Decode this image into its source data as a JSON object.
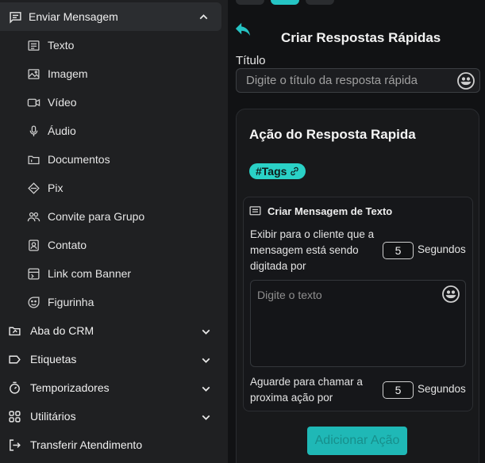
{
  "sidebar": {
    "section": {
      "label": "Enviar Mensagem",
      "icon": "message-icon",
      "expanded": true
    },
    "sub_items": [
      {
        "label": "Texto",
        "icon": "text-icon"
      },
      {
        "label": "Imagem",
        "icon": "image-icon"
      },
      {
        "label": "Vídeo",
        "icon": "video-icon"
      },
      {
        "label": "Áudio",
        "icon": "microphone-icon"
      },
      {
        "label": "Documentos",
        "icon": "folder-icon"
      },
      {
        "label": "Pix",
        "icon": "pix-icon"
      },
      {
        "label": "Convite para Grupo",
        "icon": "group-icon"
      },
      {
        "label": "Contato",
        "icon": "contact-icon"
      },
      {
        "label": "Link com Banner",
        "icon": "link-banner-icon"
      },
      {
        "label": "Figurinha",
        "icon": "sticker-icon"
      }
    ],
    "main_items": [
      {
        "label": "Aba do CRM",
        "icon": "crm-icon"
      },
      {
        "label": "Etiquetas",
        "icon": "tag-icon"
      },
      {
        "label": "Temporizadores",
        "icon": "timer-icon"
      },
      {
        "label": "Utilitários",
        "icon": "grid-icon"
      },
      {
        "label": "Transferir Atendimento",
        "icon": "transfer-icon"
      }
    ]
  },
  "panel": {
    "title": "Criar Respostas Rápidas",
    "title_field_label": "Título",
    "title_placeholder": "Digite o título da resposta rápida",
    "card_title": "Ação do Resposta Rapida",
    "tags_label": "#Tags",
    "text_message": {
      "heading": "Criar Mensagem de Texto",
      "typing_line1": "Exibir para o cliente que a",
      "typing_line2": "mensagem está sendo",
      "typing_line3": "digitada por",
      "typing_seconds": "5",
      "seconds_unit": "Segundos",
      "text_placeholder": "Digite o texto",
      "wait_line1": "Aguarde para chamar a",
      "wait_line2": "proxima ação por",
      "wait_seconds": "5",
      "wait_unit": "Segundos"
    },
    "add_action_label": "Adicionar Ação"
  },
  "colors": {
    "accent": "#25c4c4",
    "background": "#111214",
    "sidebar": "#1f2022"
  }
}
